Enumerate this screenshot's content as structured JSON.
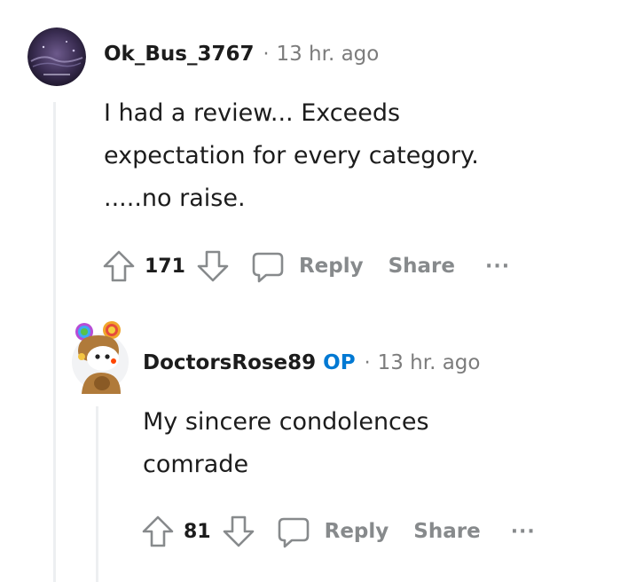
{
  "comments": [
    {
      "username": "Ok_Bus_3767",
      "separator": "·",
      "time": "13 hr. ago",
      "body": [
        "I had a review... Exceeds",
        "expectation for every category.",
        ".....no raise."
      ],
      "votes": "171",
      "reply_label": "Reply",
      "share_label": "Share",
      "more_label": "···",
      "avatar_icon": "galaxy-avatar-icon"
    },
    {
      "username": "DoctorsRose89",
      "op_badge": "OP",
      "separator": "·",
      "time": "13 hr. ago",
      "body": [
        "My sincere condolences",
        "comrade"
      ],
      "votes": "81",
      "reply_label": "Reply",
      "share_label": "Share",
      "more_label": "···",
      "avatar_icon": "bear-avatar-icon"
    }
  ],
  "colors": {
    "op": "#0079d3",
    "muted": "#878a8c",
    "thread_line": "#edeff1"
  }
}
